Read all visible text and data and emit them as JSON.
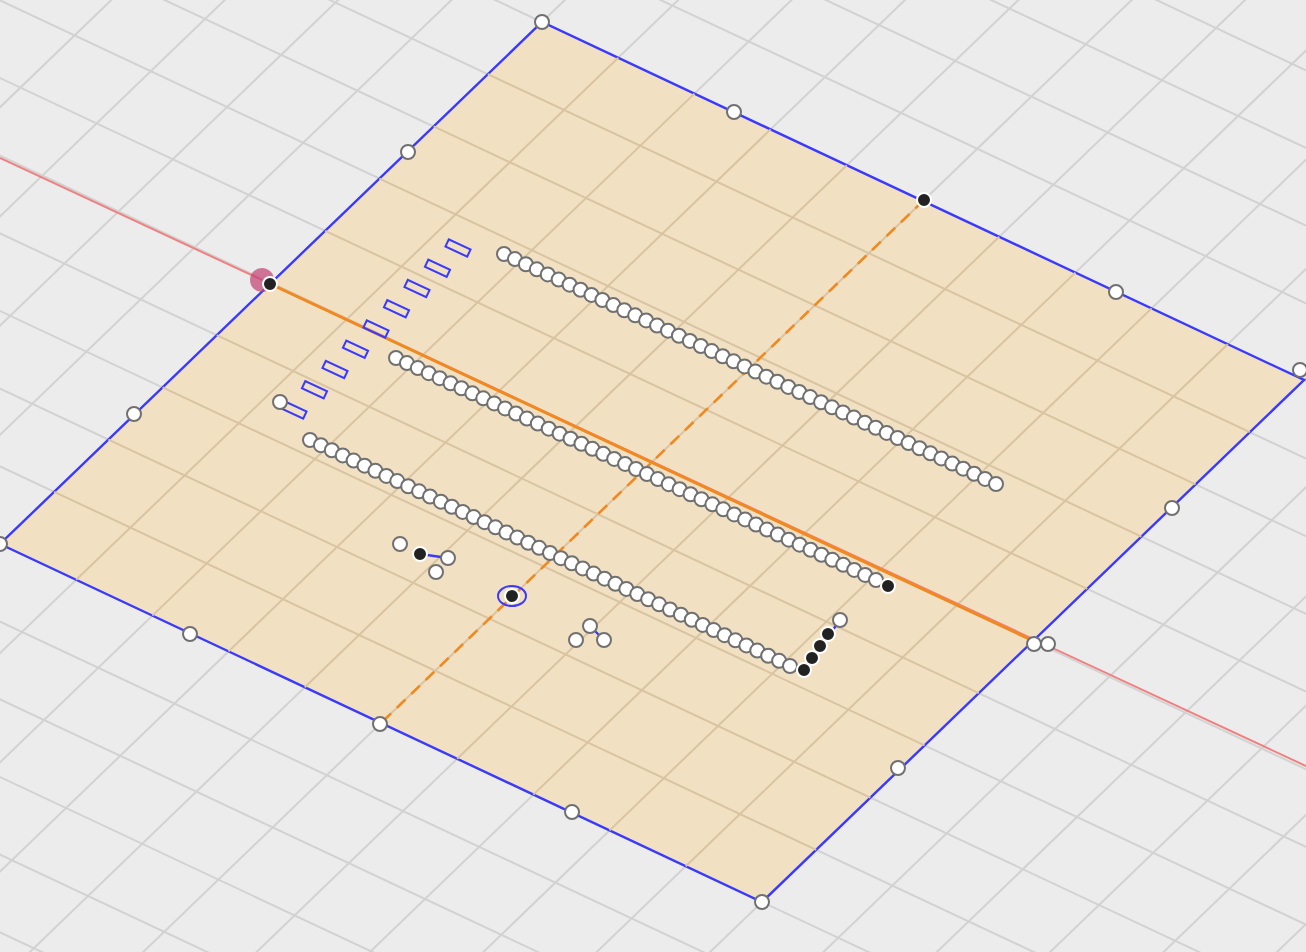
{
  "viewport": {
    "kind": "sketch"
  }
}
